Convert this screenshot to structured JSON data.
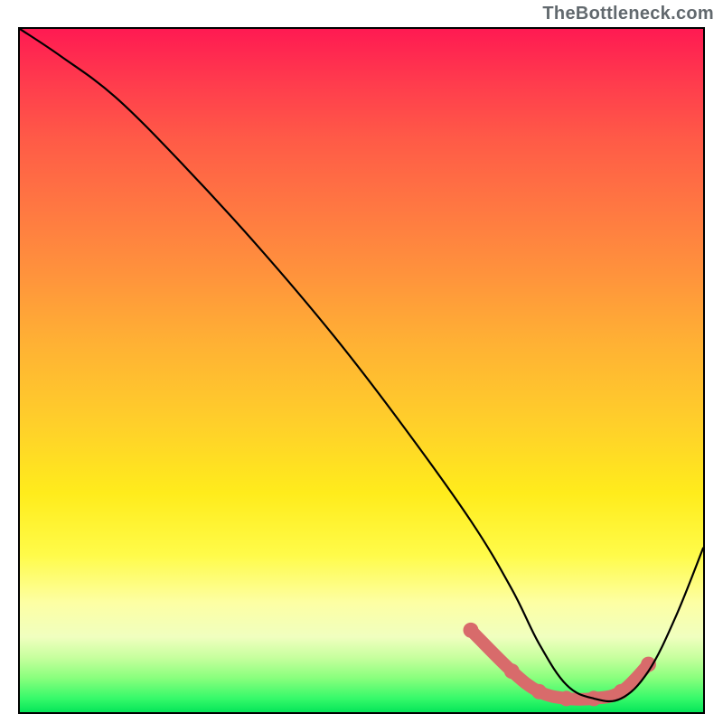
{
  "attribution": "TheBottleneck.com",
  "chart_data": {
    "type": "line",
    "title": "",
    "xlabel": "",
    "ylabel": "",
    "xlim": [
      0,
      100
    ],
    "ylim": [
      0,
      100
    ],
    "grid": false,
    "legend": false,
    "annotations": [],
    "series": [
      {
        "name": "bottleneck-curve",
        "x": [
          0,
          6,
          14,
          24,
          35,
          46,
          56,
          66,
          72,
          76,
          80,
          84,
          88,
          92,
          96,
          100
        ],
        "y": [
          100,
          96,
          90,
          80,
          68,
          55,
          42,
          28,
          18,
          10,
          4,
          2,
          2,
          6,
          14,
          24
        ]
      }
    ],
    "highlight_region": {
      "name": "optimal-band",
      "x": [
        66,
        72,
        76,
        80,
        84,
        88,
        92
      ],
      "y": [
        12,
        6,
        3,
        2,
        2,
        3,
        7
      ]
    },
    "background": {
      "type": "vertical-gradient",
      "stops": [
        {
          "pos": 0.0,
          "color": "#ff1a52"
        },
        {
          "pos": 0.5,
          "color": "#ffc030"
        },
        {
          "pos": 0.8,
          "color": "#fffb49"
        },
        {
          "pos": 1.0,
          "color": "#06e559"
        }
      ]
    }
  }
}
